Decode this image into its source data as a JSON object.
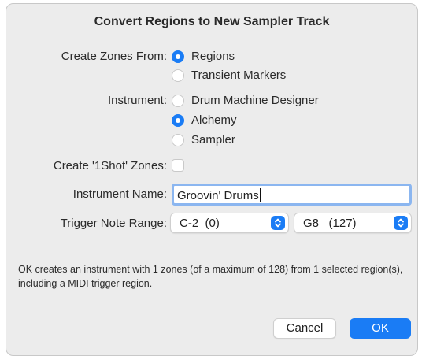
{
  "dialog": {
    "title": "Convert Regions to New Sampler Track",
    "create_zones": {
      "label": "Create Zones From:",
      "options": [
        {
          "label": "Regions",
          "checked": true
        },
        {
          "label": "Transient Markers",
          "checked": false
        }
      ]
    },
    "instrument": {
      "label": "Instrument:",
      "options": [
        {
          "label": "Drum Machine Designer",
          "checked": false
        },
        {
          "label": "Alchemy",
          "checked": true
        },
        {
          "label": "Sampler",
          "checked": false
        }
      ]
    },
    "oneshot": {
      "label": "Create '1Shot' Zones:",
      "checked": false
    },
    "instrument_name": {
      "label": "Instrument Name:",
      "value": "Groovin' Drums"
    },
    "trigger_range": {
      "label": "Trigger Note Range:",
      "low": "C-2  (0)",
      "high": "G8   (127)"
    },
    "note": "OK creates an instrument with 1 zones (of a maximum of 128) from 1 selected region(s), including a MIDI trigger region.",
    "buttons": {
      "cancel": "Cancel",
      "ok": "OK"
    },
    "colors": {
      "accent": "#1a7cf5",
      "background": "#ececec",
      "focus_ring": "#8bb6f0"
    }
  }
}
